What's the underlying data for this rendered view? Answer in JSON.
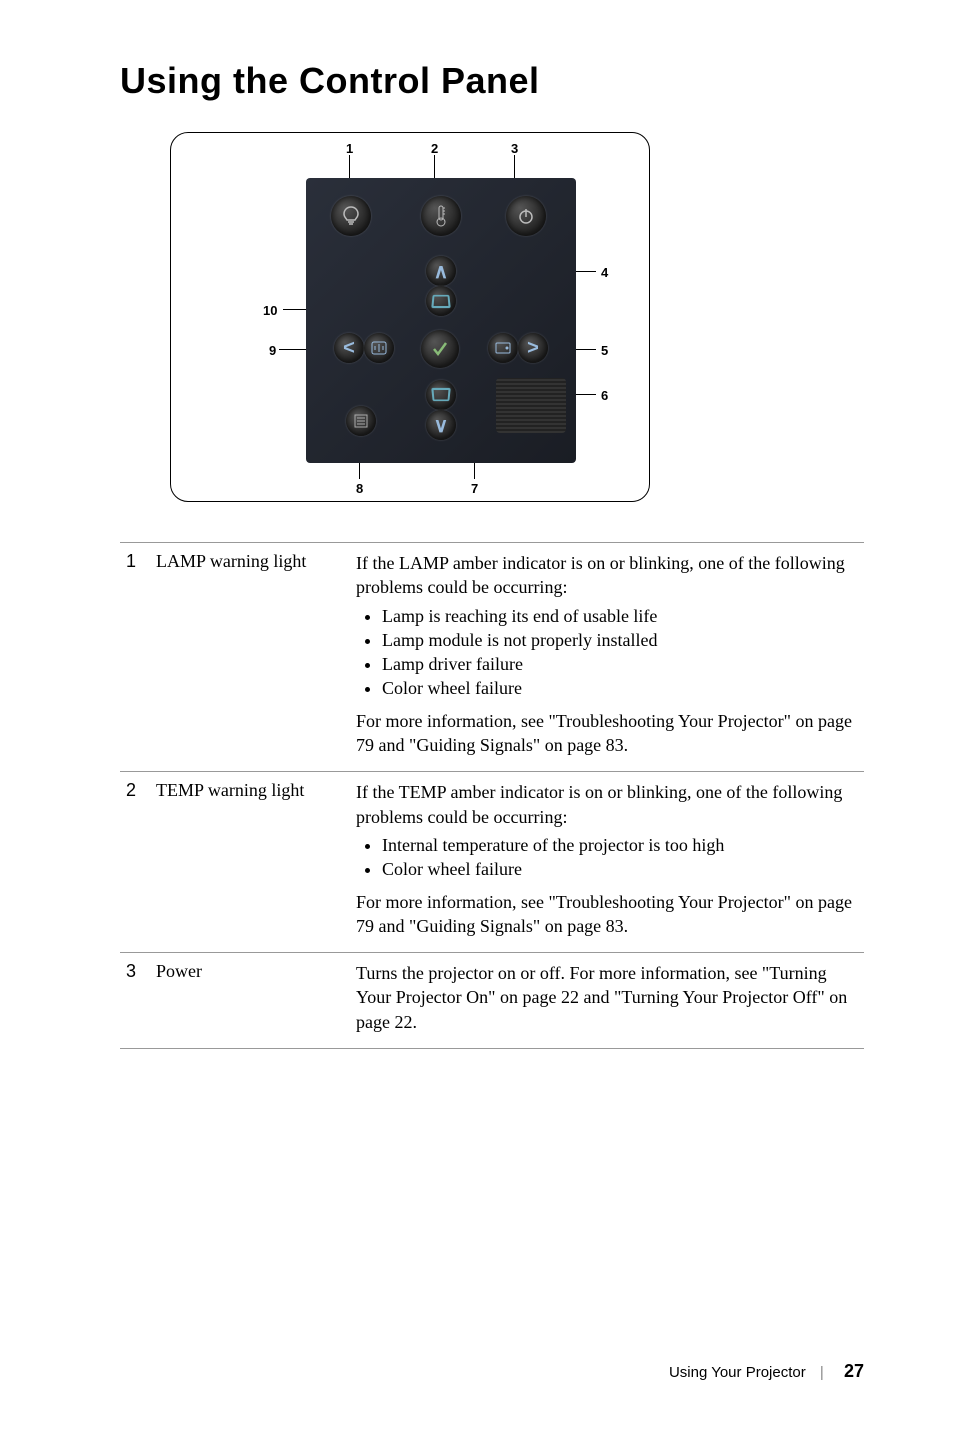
{
  "heading": "Using the Control Panel",
  "diagram": {
    "labels": {
      "n1": "1",
      "n2": "2",
      "n3": "3",
      "n4": "4",
      "n5": "5",
      "n6": "6",
      "n7": "7",
      "n8": "8",
      "n9": "9",
      "n10": "10"
    }
  },
  "rows": [
    {
      "num": "1",
      "label": "LAMP warning light",
      "intro": "If the LAMP amber indicator is on or blinking, one of the following problems could be occurring:",
      "bullets": [
        "Lamp is reaching its end of usable life",
        "Lamp module is not properly installed",
        "Lamp driver failure",
        "Color wheel failure"
      ],
      "outro": "For more information, see \"Troubleshooting Your Projector\" on page 79 and \"Guiding Signals\" on page 83."
    },
    {
      "num": "2",
      "label": "TEMP warning light",
      "intro": "If the TEMP amber indicator is on or blinking, one of the following problems could be occurring:",
      "bullets": [
        "Internal temperature of the projector is too high",
        "Color wheel failure"
      ],
      "outro": "For more information, see \"Troubleshooting Your Projector\" on page 79 and \"Guiding Signals\" on page 83."
    },
    {
      "num": "3",
      "label": "Power",
      "intro": "Turns the projector on or off. For more information, see \"Turning Your Projector On\" on page 22 and \"Turning Your Projector Off\" on page 22.",
      "bullets": [],
      "outro": ""
    }
  ],
  "footer": {
    "section": "Using Your Projector",
    "page": "27"
  }
}
